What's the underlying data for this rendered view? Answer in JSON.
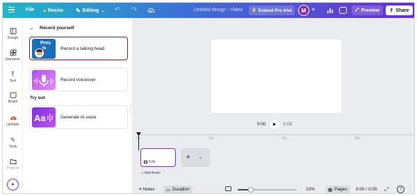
{
  "topbar": {
    "file_label": "File",
    "resize_label": "Resize",
    "editing_label": "Editing",
    "design_title": "Untitled design - Video",
    "pro_label": "Extend Pro trial",
    "avatar_initial": "M",
    "preview_label": "Preview",
    "share_label": "Share",
    "gradient_colors": [
      "#1fb8c9",
      "#3d6fd6",
      "#6a2fd1"
    ]
  },
  "rail": {
    "items": [
      {
        "label": "Design",
        "icon": "layout-icon"
      },
      {
        "label": "Elements",
        "icon": "shapes-icon"
      },
      {
        "label": "Text",
        "icon": "text-icon"
      },
      {
        "label": "Brand",
        "icon": "brand-icon"
      },
      {
        "label": "Uploads",
        "icon": "cloud-upload-icon"
      },
      {
        "label": "Tools",
        "icon": "pencil-icon"
      },
      {
        "label": "Projects",
        "icon": "folder-icon"
      }
    ],
    "active": "Uploads"
  },
  "panel": {
    "title": "Record yourself",
    "cards": [
      {
        "label": "Record a talking head",
        "selected": true
      },
      {
        "label": "Record voiceover",
        "selected": false
      }
    ],
    "tryout_heading": "Try out",
    "tryout_cards": [
      {
        "label": "Generate AI voice"
      }
    ],
    "thumb_text_1": "Pres",
    "thumb_text_2": "fe"
  },
  "player": {
    "current_time": "0:00",
    "total_time": "0:05"
  },
  "timeline": {
    "ticks": [
      "0s",
      "10s",
      "20s",
      "30s"
    ],
    "clip_duration": "5.0s",
    "add_audio_label": "Add Audio"
  },
  "footer": {
    "notes_label": "Notes",
    "duration_label": "Duration",
    "zoom_value": "22%",
    "zoom_fraction": 0.22,
    "pages_label": "Pages",
    "page_time": "0:00 / 0:05"
  },
  "accent": "#7d2ae8"
}
